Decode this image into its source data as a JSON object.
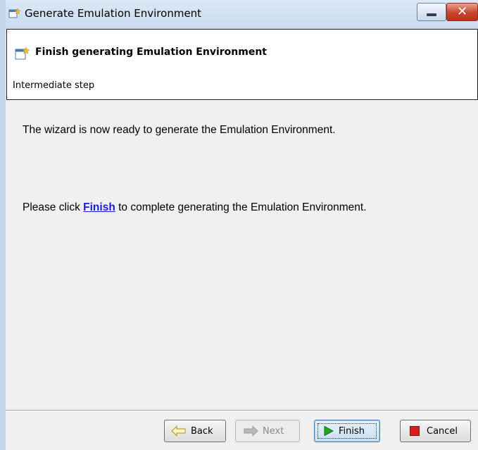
{
  "window": {
    "title": "Generate Emulation Environment",
    "close_glyph": "✕"
  },
  "header": {
    "title": "Finish generating Emulation Environment",
    "description": "Intermediate step"
  },
  "content": {
    "message_line1": "The wizard is now ready to generate the Emulation Environment.",
    "message_line2_prefix": "Please click ",
    "message_line2_link": "Finish",
    "message_line2_suffix": " to complete generating the Emulation Environment."
  },
  "buttons": {
    "back": "Back",
    "next": "Next",
    "finish": "Finish",
    "cancel": "Cancel"
  },
  "icons": {
    "window_icon": "wizard-icon",
    "header_icon": "wizard-icon",
    "back_icon": "arrow-left-icon",
    "next_icon": "arrow-right-icon",
    "finish_icon": "play-icon",
    "cancel_icon": "stop-icon"
  },
  "colors": {
    "link": "#1a1ae0",
    "finish_icon": "#22a822",
    "cancel_icon": "#d81e1e",
    "title_bar": "#c8dbee"
  }
}
